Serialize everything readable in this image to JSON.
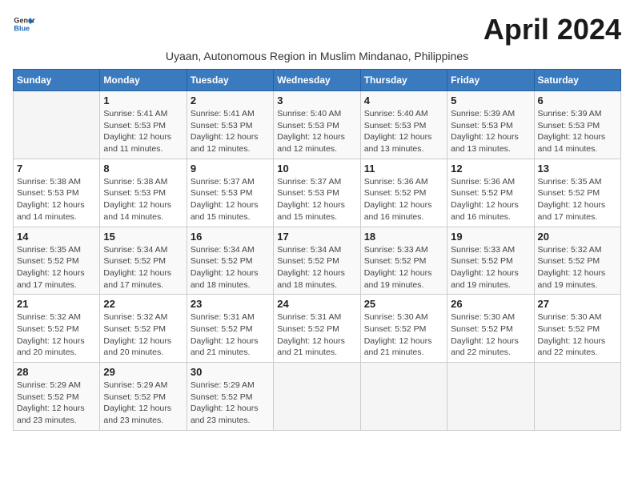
{
  "header": {
    "logo_general": "General",
    "logo_blue": "Blue",
    "title": "April 2024",
    "subtitle": "Uyaan, Autonomous Region in Muslim Mindanao, Philippines"
  },
  "days_of_week": [
    "Sunday",
    "Monday",
    "Tuesday",
    "Wednesday",
    "Thursday",
    "Friday",
    "Saturday"
  ],
  "weeks": [
    [
      {
        "day": "",
        "info": ""
      },
      {
        "day": "1",
        "info": "Sunrise: 5:41 AM\nSunset: 5:53 PM\nDaylight: 12 hours and 11 minutes."
      },
      {
        "day": "2",
        "info": "Sunrise: 5:41 AM\nSunset: 5:53 PM\nDaylight: 12 hours and 12 minutes."
      },
      {
        "day": "3",
        "info": "Sunrise: 5:40 AM\nSunset: 5:53 PM\nDaylight: 12 hours and 12 minutes."
      },
      {
        "day": "4",
        "info": "Sunrise: 5:40 AM\nSunset: 5:53 PM\nDaylight: 12 hours and 13 minutes."
      },
      {
        "day": "5",
        "info": "Sunrise: 5:39 AM\nSunset: 5:53 PM\nDaylight: 12 hours and 13 minutes."
      },
      {
        "day": "6",
        "info": "Sunrise: 5:39 AM\nSunset: 5:53 PM\nDaylight: 12 hours and 14 minutes."
      }
    ],
    [
      {
        "day": "7",
        "info": "Sunrise: 5:38 AM\nSunset: 5:53 PM\nDaylight: 12 hours and 14 minutes."
      },
      {
        "day": "8",
        "info": "Sunrise: 5:38 AM\nSunset: 5:53 PM\nDaylight: 12 hours and 14 minutes."
      },
      {
        "day": "9",
        "info": "Sunrise: 5:37 AM\nSunset: 5:53 PM\nDaylight: 12 hours and 15 minutes."
      },
      {
        "day": "10",
        "info": "Sunrise: 5:37 AM\nSunset: 5:53 PM\nDaylight: 12 hours and 15 minutes."
      },
      {
        "day": "11",
        "info": "Sunrise: 5:36 AM\nSunset: 5:52 PM\nDaylight: 12 hours and 16 minutes."
      },
      {
        "day": "12",
        "info": "Sunrise: 5:36 AM\nSunset: 5:52 PM\nDaylight: 12 hours and 16 minutes."
      },
      {
        "day": "13",
        "info": "Sunrise: 5:35 AM\nSunset: 5:52 PM\nDaylight: 12 hours and 17 minutes."
      }
    ],
    [
      {
        "day": "14",
        "info": "Sunrise: 5:35 AM\nSunset: 5:52 PM\nDaylight: 12 hours and 17 minutes."
      },
      {
        "day": "15",
        "info": "Sunrise: 5:34 AM\nSunset: 5:52 PM\nDaylight: 12 hours and 17 minutes."
      },
      {
        "day": "16",
        "info": "Sunrise: 5:34 AM\nSunset: 5:52 PM\nDaylight: 12 hours and 18 minutes."
      },
      {
        "day": "17",
        "info": "Sunrise: 5:34 AM\nSunset: 5:52 PM\nDaylight: 12 hours and 18 minutes."
      },
      {
        "day": "18",
        "info": "Sunrise: 5:33 AM\nSunset: 5:52 PM\nDaylight: 12 hours and 19 minutes."
      },
      {
        "day": "19",
        "info": "Sunrise: 5:33 AM\nSunset: 5:52 PM\nDaylight: 12 hours and 19 minutes."
      },
      {
        "day": "20",
        "info": "Sunrise: 5:32 AM\nSunset: 5:52 PM\nDaylight: 12 hours and 19 minutes."
      }
    ],
    [
      {
        "day": "21",
        "info": "Sunrise: 5:32 AM\nSunset: 5:52 PM\nDaylight: 12 hours and 20 minutes."
      },
      {
        "day": "22",
        "info": "Sunrise: 5:32 AM\nSunset: 5:52 PM\nDaylight: 12 hours and 20 minutes."
      },
      {
        "day": "23",
        "info": "Sunrise: 5:31 AM\nSunset: 5:52 PM\nDaylight: 12 hours and 21 minutes."
      },
      {
        "day": "24",
        "info": "Sunrise: 5:31 AM\nSunset: 5:52 PM\nDaylight: 12 hours and 21 minutes."
      },
      {
        "day": "25",
        "info": "Sunrise: 5:30 AM\nSunset: 5:52 PM\nDaylight: 12 hours and 21 minutes."
      },
      {
        "day": "26",
        "info": "Sunrise: 5:30 AM\nSunset: 5:52 PM\nDaylight: 12 hours and 22 minutes."
      },
      {
        "day": "27",
        "info": "Sunrise: 5:30 AM\nSunset: 5:52 PM\nDaylight: 12 hours and 22 minutes."
      }
    ],
    [
      {
        "day": "28",
        "info": "Sunrise: 5:29 AM\nSunset: 5:52 PM\nDaylight: 12 hours and 23 minutes."
      },
      {
        "day": "29",
        "info": "Sunrise: 5:29 AM\nSunset: 5:52 PM\nDaylight: 12 hours and 23 minutes."
      },
      {
        "day": "30",
        "info": "Sunrise: 5:29 AM\nSunset: 5:52 PM\nDaylight: 12 hours and 23 minutes."
      },
      {
        "day": "",
        "info": ""
      },
      {
        "day": "",
        "info": ""
      },
      {
        "day": "",
        "info": ""
      },
      {
        "day": "",
        "info": ""
      }
    ]
  ]
}
